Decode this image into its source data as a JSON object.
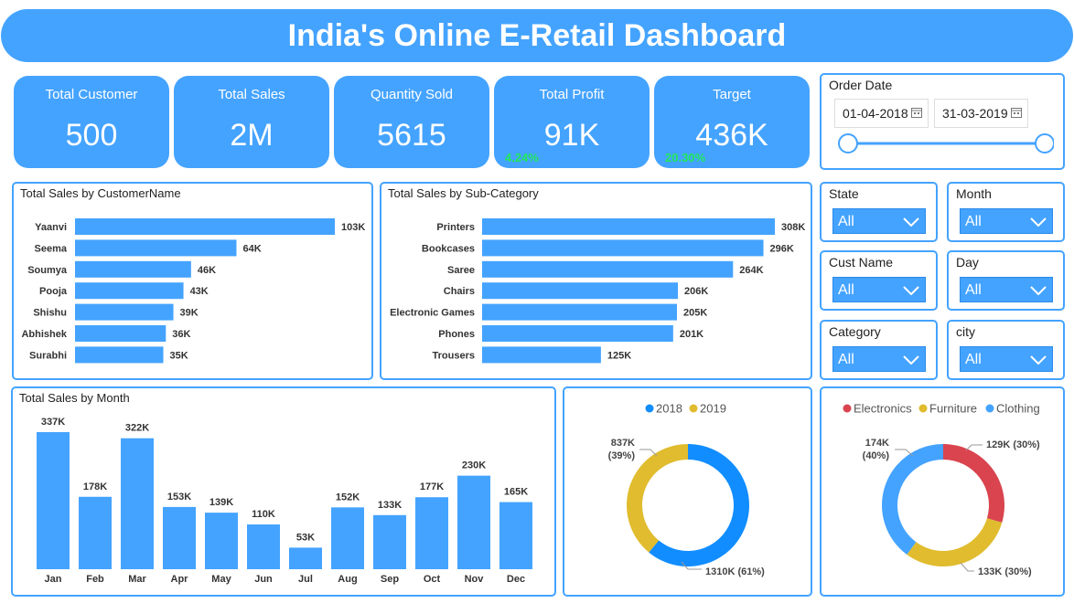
{
  "header": {
    "title": "India's Online E-Retail Dashboard"
  },
  "kpis": [
    {
      "label": "Total Customer",
      "value": "500"
    },
    {
      "label": "Total Sales",
      "value": "2M"
    },
    {
      "label": "Quantity Sold",
      "value": "5615"
    },
    {
      "label": "Total Profit",
      "value": "91K",
      "badge": "4.24%"
    },
    {
      "label": "Target",
      "value": "436K",
      "badge": "20.30%"
    }
  ],
  "order_date": {
    "label": "Order Date",
    "start": "01-04-2018",
    "end": "31-03-2019"
  },
  "slicers": {
    "state": {
      "label": "State",
      "value": "All"
    },
    "month": {
      "label": "Month",
      "value": "All"
    },
    "cust_name": {
      "label": "Cust Name",
      "value": "All"
    },
    "day": {
      "label": "Day",
      "value": "All"
    },
    "category": {
      "label": "Category",
      "value": "All"
    },
    "city": {
      "label": "city",
      "value": "All"
    }
  },
  "colors": {
    "accent": "#44a3ff",
    "bar": "#44a3ff",
    "y2018": "#118dff",
    "y2019": "#e0bc2e",
    "electronics": "#d9444e",
    "furniture": "#e0bc2e",
    "clothing": "#44a3ff",
    "positive": "#22e85a"
  },
  "chart_data": [
    {
      "id": "customer",
      "type": "bar",
      "orientation": "horizontal",
      "title": "Total Sales by CustomerName",
      "categories": [
        "Yaanvi",
        "Seema",
        "Soumya",
        "Pooja",
        "Shishu",
        "Abhishek",
        "Surabhi"
      ],
      "values": [
        103,
        64,
        46,
        43,
        39,
        36,
        35
      ],
      "labels": [
        "103K",
        "64K",
        "46K",
        "43K",
        "39K",
        "36K",
        "35K"
      ]
    },
    {
      "id": "subcat",
      "type": "bar",
      "orientation": "horizontal",
      "title": "Total Sales by Sub-Category",
      "categories": [
        "Printers",
        "Bookcases",
        "Saree",
        "Chairs",
        "Electronic Games",
        "Phones",
        "Trousers"
      ],
      "values": [
        308,
        296,
        264,
        206,
        205,
        201,
        125
      ],
      "labels": [
        "308K",
        "296K",
        "264K",
        "206K",
        "205K",
        "201K",
        "125K"
      ]
    },
    {
      "id": "month",
      "type": "bar",
      "title": "Total Sales by Month",
      "categories": [
        "Jan",
        "Feb",
        "Mar",
        "Apr",
        "May",
        "Jun",
        "Jul",
        "Aug",
        "Sep",
        "Oct",
        "Nov",
        "Dec"
      ],
      "values": [
        337,
        178,
        322,
        153,
        139,
        110,
        53,
        152,
        133,
        177,
        230,
        165
      ],
      "labels": [
        "337K",
        "178K",
        "322K",
        "153K",
        "139K",
        "110K",
        "53K",
        "152K",
        "133K",
        "177K",
        "230K",
        "165K"
      ]
    },
    {
      "id": "year",
      "type": "pie",
      "legend": [
        "2018",
        "2019"
      ],
      "values": [
        1310,
        837
      ],
      "labels": [
        "1310K (61%)",
        "837K (39%)"
      ]
    },
    {
      "id": "category",
      "type": "pie",
      "legend": [
        "Electronics",
        "Furniture",
        "Clothing"
      ],
      "values": [
        129,
        133,
        174
      ],
      "labels": [
        "129K (30%)",
        "133K (30%)",
        "174K (40%)"
      ]
    }
  ]
}
